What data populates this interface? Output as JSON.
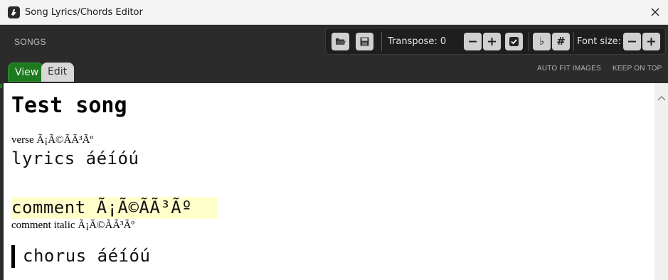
{
  "window": {
    "title": "Song Lyrics/Chords Editor",
    "app_icon": "app-logo-icon",
    "close_icon": "close-icon"
  },
  "header": {
    "songs_label": "SONGS",
    "toolbar": {
      "open_icon": "folder-open-icon",
      "save_icon": "save-icon",
      "transpose_label": "Transpose: 0",
      "transpose_down_icon": "minus-icon",
      "transpose_up_icon": "plus-icon",
      "check_icon": "checkbox-icon",
      "flat_label": "♭",
      "sharp_label": "#",
      "font_size_label": "Font size:",
      "font_down_icon": "minus-icon",
      "font_up_icon": "plus-icon"
    },
    "tabs": [
      {
        "label": "View",
        "active": true
      },
      {
        "label": "Edit",
        "active": false
      }
    ],
    "links": {
      "auto_fit": "AUTO FIT IMAGES",
      "keep_on_top": "KEEP ON TOP"
    }
  },
  "song": {
    "title": "Test song",
    "verse_label": "verse Ã¡Ã©ÃÃ³Ãº",
    "lyrics_line": "lyrics áéíóú",
    "comment_line": "comment Ã¡Ã©ÃÃ³Ãº",
    "comment_italic": "comment italic Ã¡Ã©ÃÃ³Ãº",
    "chorus_line": "chorus áéíóú"
  },
  "colors": {
    "accent_green": "#1e7a1e",
    "header_bg": "#2b2b2b",
    "comment_highlight": "#ffffcc"
  }
}
